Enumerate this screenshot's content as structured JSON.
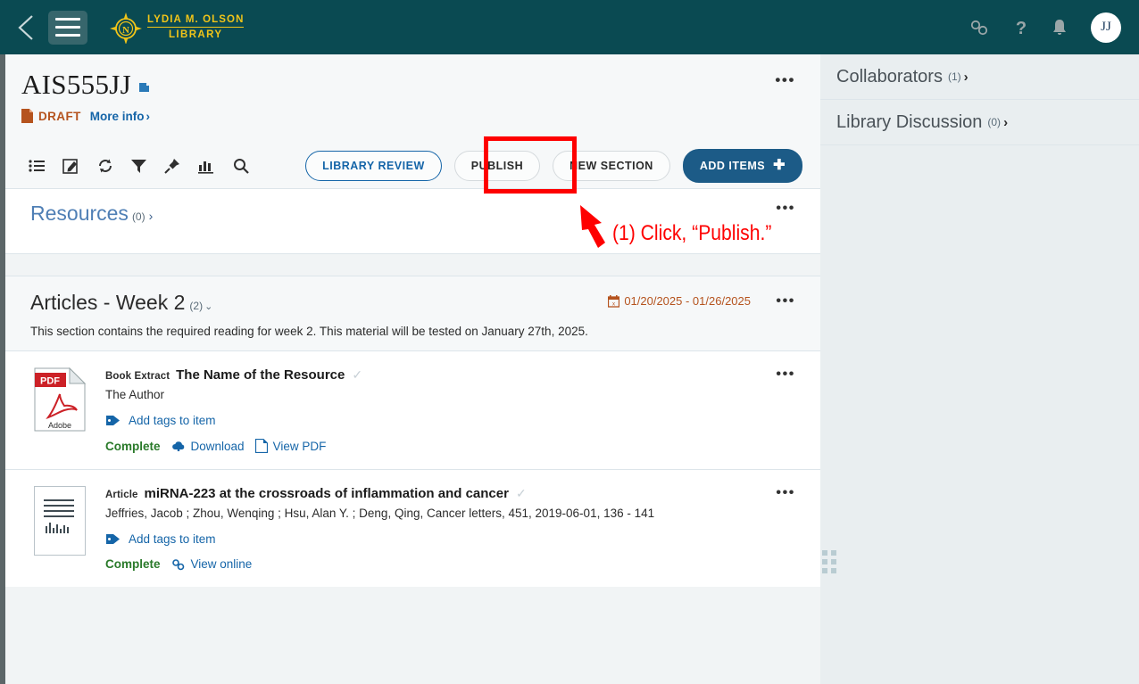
{
  "topbar": {
    "back_icon": "chevron-left-icon",
    "menu_icon": "hamburger-menu-icon",
    "logo_line1": "LYDIA M. OLSON",
    "logo_line2": "LIBRARY",
    "icons": [
      {
        "name": "link-chain-icon",
        "glyph": "link"
      },
      {
        "name": "help-question-icon",
        "glyph": "?"
      },
      {
        "name": "notifications-bell-icon",
        "glyph": "bell"
      }
    ],
    "avatar_initials": "JJ",
    "bg_color": "#0a4a52",
    "logo_color": "#f0c419"
  },
  "page_header": {
    "title": "AIS555JJ",
    "copy_icon": "copy-icon",
    "status_badge": "DRAFT",
    "status_color": "#b5531e",
    "more_info_label": "More info",
    "overflow_menu": "•••"
  },
  "toolbar": {
    "icons": [
      {
        "name": "list-view-icon"
      },
      {
        "name": "edit-note-icon"
      },
      {
        "name": "refresh-icon"
      },
      {
        "name": "filter-icon"
      },
      {
        "name": "pin-icon"
      },
      {
        "name": "analytics-bar-chart-icon"
      },
      {
        "name": "search-icon"
      }
    ],
    "buttons": {
      "library_review": "LIBRARY REVIEW",
      "publish": "PUBLISH",
      "new_section": "NEW SECTION",
      "add_items": "ADD ITEMS"
    },
    "accent_blue": "#1565a8",
    "primary_blue": "#1c5b87"
  },
  "resources_section": {
    "title": "Resources",
    "count": "(0)",
    "overflow_menu": "•••"
  },
  "section": {
    "title": "Articles - Week 2",
    "count": "(2)",
    "date_range": "01/20/2025 - 01/26/2025",
    "calendar_icon": "calendar-icon",
    "description": "This section contains the required reading for week 2. This material will be tested on January 27th, 2025.",
    "overflow_menu": "•••"
  },
  "items": [
    {
      "thumb_icon": "pdf-file-icon",
      "thumb_label_top": "PDF",
      "thumb_label_bottom": "Adobe",
      "type": "Book Extract",
      "name": "The Name of the Resource",
      "author": "The Author",
      "tags_label": "Add tags to item",
      "tags_icon": "tag-icon",
      "status": "Complete",
      "actions": [
        {
          "label": "Download",
          "icon": "download-cloud-icon"
        },
        {
          "label": "View PDF",
          "icon": "pdf-page-icon"
        }
      ],
      "overflow_menu": "•••"
    },
    {
      "thumb_icon": "document-page-icon",
      "type": "Article",
      "name": "miRNA-223 at the crossroads of inflammation and cancer",
      "author": "Jeffries, Jacob ; Zhou, Wenqing ; Hsu, Alan Y. ; Deng, Qing, Cancer letters, 451, 2019-06-01, 136 - 141",
      "tags_label": "Add tags to item",
      "tags_icon": "tag-icon",
      "status": "Complete",
      "actions": [
        {
          "label": "View online",
          "icon": "link-icon"
        }
      ],
      "overflow_menu": "•••"
    }
  ],
  "right_panel": {
    "rows": [
      {
        "label": "Collaborators",
        "count": "(1)",
        "chevron": "›"
      },
      {
        "label": "Library Discussion",
        "count": "(0)",
        "chevron": "›"
      }
    ],
    "drag_handle": "panel-resize-handle"
  },
  "annotation": {
    "highlight_target": "publish-button",
    "text": "(1) Click, “Publish.”",
    "color": "#fe0000"
  }
}
